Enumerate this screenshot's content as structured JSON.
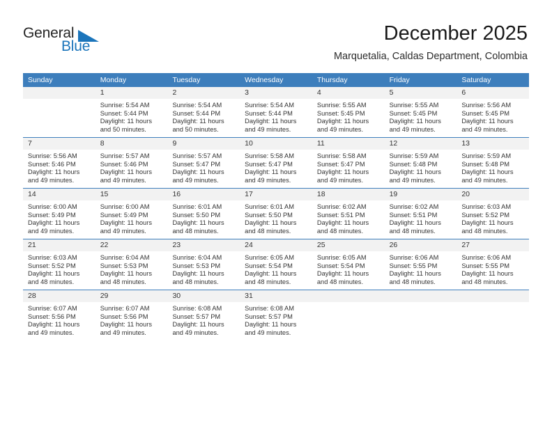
{
  "brand": {
    "name_part1": "General",
    "name_part2": "Blue",
    "logo_icon": "triangle-flag-icon",
    "accent_color": "#1b75bb"
  },
  "header": {
    "title": "December 2025",
    "subtitle": "Marquetalia, Caldas Department, Colombia"
  },
  "calendar": {
    "header_bg_color": "#3d7ebc",
    "day_band_color": "#f2f2f2",
    "weekdays": [
      "Sunday",
      "Monday",
      "Tuesday",
      "Wednesday",
      "Thursday",
      "Friday",
      "Saturday"
    ],
    "weeks": [
      [
        {
          "day": "",
          "lines": []
        },
        {
          "day": "1",
          "lines": [
            "Sunrise: 5:54 AM",
            "Sunset: 5:44 PM",
            "Daylight: 11 hours",
            "and 50 minutes."
          ]
        },
        {
          "day": "2",
          "lines": [
            "Sunrise: 5:54 AM",
            "Sunset: 5:44 PM",
            "Daylight: 11 hours",
            "and 50 minutes."
          ]
        },
        {
          "day": "3",
          "lines": [
            "Sunrise: 5:54 AM",
            "Sunset: 5:44 PM",
            "Daylight: 11 hours",
            "and 49 minutes."
          ]
        },
        {
          "day": "4",
          "lines": [
            "Sunrise: 5:55 AM",
            "Sunset: 5:45 PM",
            "Daylight: 11 hours",
            "and 49 minutes."
          ]
        },
        {
          "day": "5",
          "lines": [
            "Sunrise: 5:55 AM",
            "Sunset: 5:45 PM",
            "Daylight: 11 hours",
            "and 49 minutes."
          ]
        },
        {
          "day": "6",
          "lines": [
            "Sunrise: 5:56 AM",
            "Sunset: 5:45 PM",
            "Daylight: 11 hours",
            "and 49 minutes."
          ]
        }
      ],
      [
        {
          "day": "7",
          "lines": [
            "Sunrise: 5:56 AM",
            "Sunset: 5:46 PM",
            "Daylight: 11 hours",
            "and 49 minutes."
          ]
        },
        {
          "day": "8",
          "lines": [
            "Sunrise: 5:57 AM",
            "Sunset: 5:46 PM",
            "Daylight: 11 hours",
            "and 49 minutes."
          ]
        },
        {
          "day": "9",
          "lines": [
            "Sunrise: 5:57 AM",
            "Sunset: 5:47 PM",
            "Daylight: 11 hours",
            "and 49 minutes."
          ]
        },
        {
          "day": "10",
          "lines": [
            "Sunrise: 5:58 AM",
            "Sunset: 5:47 PM",
            "Daylight: 11 hours",
            "and 49 minutes."
          ]
        },
        {
          "day": "11",
          "lines": [
            "Sunrise: 5:58 AM",
            "Sunset: 5:47 PM",
            "Daylight: 11 hours",
            "and 49 minutes."
          ]
        },
        {
          "day": "12",
          "lines": [
            "Sunrise: 5:59 AM",
            "Sunset: 5:48 PM",
            "Daylight: 11 hours",
            "and 49 minutes."
          ]
        },
        {
          "day": "13",
          "lines": [
            "Sunrise: 5:59 AM",
            "Sunset: 5:48 PM",
            "Daylight: 11 hours",
            "and 49 minutes."
          ]
        }
      ],
      [
        {
          "day": "14",
          "lines": [
            "Sunrise: 6:00 AM",
            "Sunset: 5:49 PM",
            "Daylight: 11 hours",
            "and 49 minutes."
          ]
        },
        {
          "day": "15",
          "lines": [
            "Sunrise: 6:00 AM",
            "Sunset: 5:49 PM",
            "Daylight: 11 hours",
            "and 49 minutes."
          ]
        },
        {
          "day": "16",
          "lines": [
            "Sunrise: 6:01 AM",
            "Sunset: 5:50 PM",
            "Daylight: 11 hours",
            "and 48 minutes."
          ]
        },
        {
          "day": "17",
          "lines": [
            "Sunrise: 6:01 AM",
            "Sunset: 5:50 PM",
            "Daylight: 11 hours",
            "and 48 minutes."
          ]
        },
        {
          "day": "18",
          "lines": [
            "Sunrise: 6:02 AM",
            "Sunset: 5:51 PM",
            "Daylight: 11 hours",
            "and 48 minutes."
          ]
        },
        {
          "day": "19",
          "lines": [
            "Sunrise: 6:02 AM",
            "Sunset: 5:51 PM",
            "Daylight: 11 hours",
            "and 48 minutes."
          ]
        },
        {
          "day": "20",
          "lines": [
            "Sunrise: 6:03 AM",
            "Sunset: 5:52 PM",
            "Daylight: 11 hours",
            "and 48 minutes."
          ]
        }
      ],
      [
        {
          "day": "21",
          "lines": [
            "Sunrise: 6:03 AM",
            "Sunset: 5:52 PM",
            "Daylight: 11 hours",
            "and 48 minutes."
          ]
        },
        {
          "day": "22",
          "lines": [
            "Sunrise: 6:04 AM",
            "Sunset: 5:53 PM",
            "Daylight: 11 hours",
            "and 48 minutes."
          ]
        },
        {
          "day": "23",
          "lines": [
            "Sunrise: 6:04 AM",
            "Sunset: 5:53 PM",
            "Daylight: 11 hours",
            "and 48 minutes."
          ]
        },
        {
          "day": "24",
          "lines": [
            "Sunrise: 6:05 AM",
            "Sunset: 5:54 PM",
            "Daylight: 11 hours",
            "and 48 minutes."
          ]
        },
        {
          "day": "25",
          "lines": [
            "Sunrise: 6:05 AM",
            "Sunset: 5:54 PM",
            "Daylight: 11 hours",
            "and 48 minutes."
          ]
        },
        {
          "day": "26",
          "lines": [
            "Sunrise: 6:06 AM",
            "Sunset: 5:55 PM",
            "Daylight: 11 hours",
            "and 48 minutes."
          ]
        },
        {
          "day": "27",
          "lines": [
            "Sunrise: 6:06 AM",
            "Sunset: 5:55 PM",
            "Daylight: 11 hours",
            "and 48 minutes."
          ]
        }
      ],
      [
        {
          "day": "28",
          "lines": [
            "Sunrise: 6:07 AM",
            "Sunset: 5:56 PM",
            "Daylight: 11 hours",
            "and 49 minutes."
          ]
        },
        {
          "day": "29",
          "lines": [
            "Sunrise: 6:07 AM",
            "Sunset: 5:56 PM",
            "Daylight: 11 hours",
            "and 49 minutes."
          ]
        },
        {
          "day": "30",
          "lines": [
            "Sunrise: 6:08 AM",
            "Sunset: 5:57 PM",
            "Daylight: 11 hours",
            "and 49 minutes."
          ]
        },
        {
          "day": "31",
          "lines": [
            "Sunrise: 6:08 AM",
            "Sunset: 5:57 PM",
            "Daylight: 11 hours",
            "and 49 minutes."
          ]
        },
        {
          "day": "",
          "lines": []
        },
        {
          "day": "",
          "lines": []
        },
        {
          "day": "",
          "lines": []
        }
      ]
    ]
  }
}
